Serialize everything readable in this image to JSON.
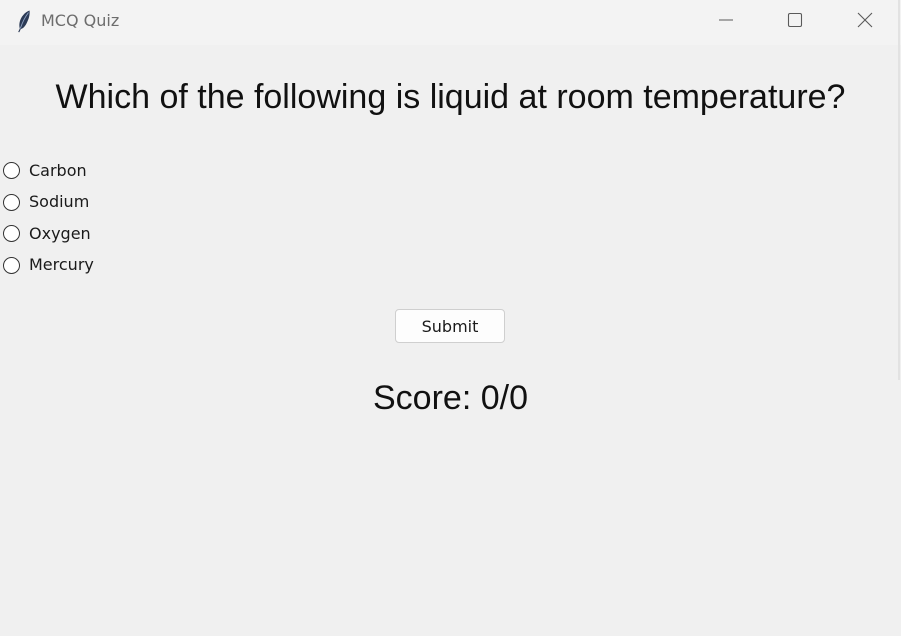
{
  "window": {
    "title": "MCQ Quiz",
    "icon": "feather-icon",
    "controls": {
      "minimize_icon": "minimize-icon",
      "maximize_icon": "maximize-icon",
      "close_icon": "close-icon"
    }
  },
  "quiz": {
    "question": "Which of the following is liquid at room temperature?",
    "options": [
      {
        "label": "Carbon",
        "selected": false
      },
      {
        "label": "Sodium",
        "selected": false
      },
      {
        "label": "Oxygen",
        "selected": false
      },
      {
        "label": "Mercury",
        "selected": false
      }
    ],
    "submit_label": "Submit",
    "score_text": "Score: 0/0"
  },
  "colors": {
    "background": "#f0f0f0",
    "titlebar": "#f3f3f3",
    "text": "#111111",
    "title_text": "#6d6d6d"
  }
}
